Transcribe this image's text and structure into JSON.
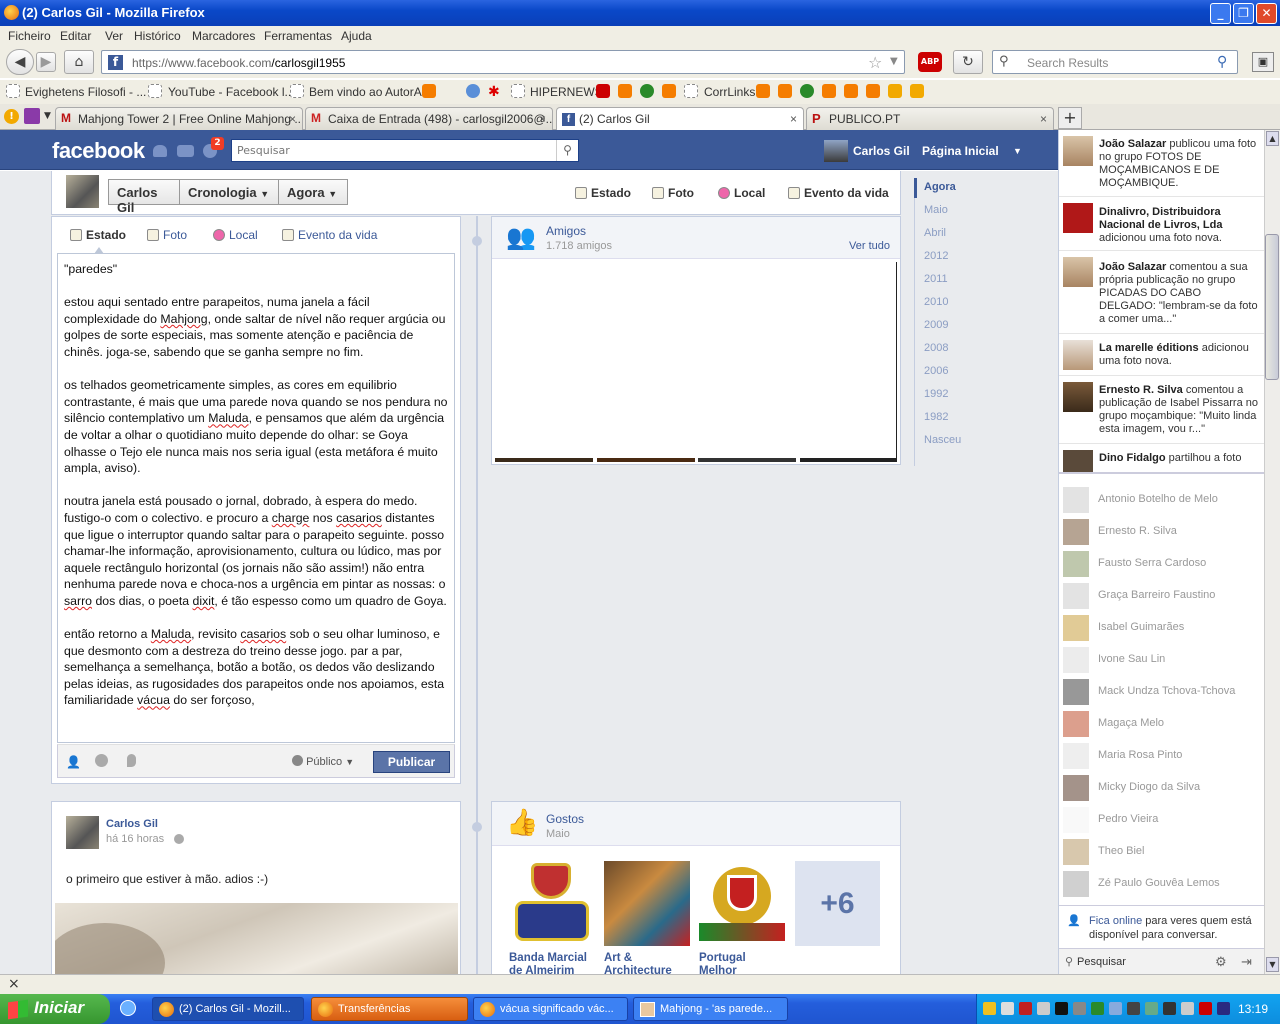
{
  "window": {
    "title": "(2) Carlos Gil - Mozilla Firefox"
  },
  "menu": [
    "Ficheiro",
    "Editar",
    "Ver",
    "Histórico",
    "Marcadores",
    "Ferramentas",
    "Ajuda"
  ],
  "nav": {
    "url_host": "https://www.facebook.com",
    "url_path": "/carlosgil1955",
    "search_placeholder": "Search Results",
    "abp": "ABP"
  },
  "bookmarks": [
    "Evighetens Filosofi - ...",
    "YouTube - Facebook l...",
    "Bem vindo ao AutorAL",
    "HIPERNEWS",
    "CorrLinks"
  ],
  "tabs": [
    {
      "label": "Mahjong Tower 2 | Free Online Mahjong ...",
      "color": "#b11"
    },
    {
      "label": "Caixa de Entrada (498) - carlosgil2006@...",
      "color": "#c22"
    },
    {
      "label": "(2) Carlos Gil",
      "color": "#3b5998"
    },
    {
      "label": "PUBLICO.PT",
      "color": "#b11"
    }
  ],
  "fb": {
    "logo": "facebook",
    "badge": "2",
    "search_placeholder": "Pesquisar",
    "user": "Carlos Gil",
    "home": "Página Inicial",
    "cover": {
      "name": "Carlos Gil",
      "timeline": "Cronologia",
      "now": "Agora",
      "actions": [
        "Estado",
        "Foto",
        "Local",
        "Evento da vida"
      ]
    },
    "composer": {
      "tabs": [
        "Estado",
        "Foto",
        "Local",
        "Evento da vida"
      ],
      "privacy": "Público",
      "publish": "Publicar"
    },
    "friends": {
      "title": "Amigos",
      "count": "1.718 amigos",
      "see_all": "Ver tudo"
    },
    "years": [
      "Agora",
      "Maio",
      "Abril",
      "2012",
      "2011",
      "2010",
      "2009",
      "2008",
      "2006",
      "1992",
      "1982",
      "Nasceu"
    ],
    "post": {
      "author": "Carlos Gil",
      "time": "há 16 horas",
      "text": "o primeiro que estiver à mão. adios :-)"
    },
    "likes": {
      "title": "Gostos",
      "sub": "Maio",
      "items": [
        "Banda Marcial de Almeirim",
        "Art & Architecture",
        "Portugal Melhor"
      ],
      "more": "+6"
    },
    "ticker": [
      {
        "name": "João Salazar",
        "text": " publicou uma foto no grupo FOTOS DE MOÇAMBICANOS E DE MOÇAMBIQUE."
      },
      {
        "name": "Dinalivro, Distribuidora Nacional de Livros, Lda",
        "text": " adicionou uma foto nova."
      },
      {
        "name": "João Salazar",
        "text": " comentou a sua própria publicação no grupo PICADAS DO CABO DELGADO: \"lembram-se da foto a comer uma...\""
      },
      {
        "name": "La marelle éditions",
        "text": " adicionou uma foto nova."
      },
      {
        "name": "Ernesto R. Silva",
        "text": " comentou a publicação de Isabel Pissarra no grupo moçambique: \"Muito linda esta imagem, vou r...\""
      },
      {
        "name": "Dino Fidalgo",
        "text": " partilhou a foto"
      }
    ],
    "chat": [
      "Antonio Botelho de Melo",
      "Ernesto R. Silva",
      "Fausto Serra Cardoso",
      "Graça Barreiro Faustino",
      "Isabel Guimarães",
      "Ivone Sau Lin",
      "Mack Undza Tchova-Tchova",
      "Magaça Melo",
      "Maria Rosa Pinto",
      "Micky Diogo da Silva",
      "Pedro Vieira",
      "Theo Biel",
      "Zé Paulo Gouvêa Lemos"
    ],
    "chat_online_link": "Fica online",
    "chat_online_text": " para veres quem está disponível para conversar.",
    "chat_search": "Pesquisar"
  },
  "taskbar": {
    "start": "Iniciar",
    "tasks": [
      "(2) Carlos Gil - Mozill...",
      "Transferências",
      "vácua significado vác...",
      "Mahjong - 'as parede..."
    ],
    "clock": "13:19"
  },
  "status_close": "×"
}
